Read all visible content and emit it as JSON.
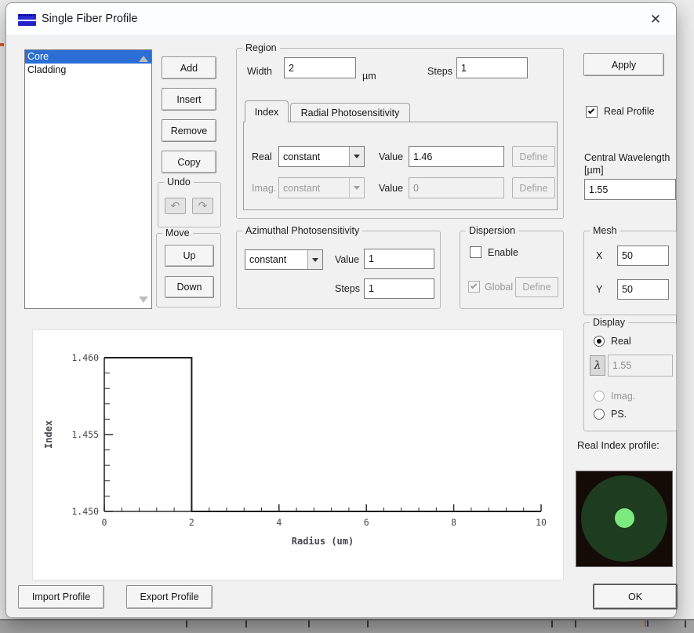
{
  "window": {
    "title": "Single Fiber Profile",
    "close_label": "✕"
  },
  "colors": {
    "selection_blue": "#2b6fd6",
    "title_icon_blue": "#2323cc",
    "profile_background": "#140a06",
    "profile_outer_circle": "#1e3c20",
    "profile_inner_circle": "#7ce97e"
  },
  "layer_list": {
    "items": [
      {
        "label": "Core",
        "selected": true
      },
      {
        "label": "Cladding",
        "selected": false
      }
    ]
  },
  "list_buttons": {
    "add": "Add",
    "insert": "Insert",
    "remove": "Remove",
    "copy": "Copy"
  },
  "undo_group": {
    "label": "Undo",
    "undo_icon": "↶",
    "redo_icon": "↷"
  },
  "move_group": {
    "label": "Move",
    "up": "Up",
    "down": "Down"
  },
  "region": {
    "label": "Region",
    "width_label": "Width",
    "width_value": "2",
    "width_unit": "µm",
    "steps_label": "Steps",
    "steps_value": "1",
    "tabs": {
      "index": "Index",
      "radial": "Radial Photosensitivity"
    },
    "real_label": "Real",
    "real_function": "constant",
    "real_value_label": "Value",
    "real_value": "1.46",
    "real_define": "Define",
    "imag_label": "Imag.",
    "imag_function": "constant",
    "imag_value_label": "Value",
    "imag_value": "0",
    "imag_define": "Define"
  },
  "right_panel": {
    "apply": "Apply",
    "real_profile": "Real Profile",
    "central_wavelength_label": "Central Wavelength [µm]",
    "central_wavelength_value": "1.55"
  },
  "azimuthal": {
    "label": "Azimuthal Photosensitivity",
    "function": "constant",
    "value_label": "Value",
    "value": "1",
    "steps_label": "Steps",
    "steps": "1"
  },
  "dispersion": {
    "label": "Dispersion",
    "enable": "Enable",
    "global": "Global",
    "define": "Define"
  },
  "mesh": {
    "label": "Mesh",
    "x_label": "X",
    "x_value": "50",
    "y_label": "Y",
    "y_value": "50"
  },
  "display": {
    "label": "Display",
    "real": "Real",
    "lambda": "λ",
    "lambda_value": "1.55",
    "imag": "Imag.",
    "ps": "PS."
  },
  "profile_preview": {
    "label": "Real Index profile:"
  },
  "chart_data": {
    "type": "line",
    "title": "",
    "xlabel": "Radius (um)",
    "ylabel": "Index",
    "xlim": [
      0,
      10
    ],
    "ylim": [
      1.45,
      1.46
    ],
    "xticks": [
      0,
      2,
      4,
      6,
      8,
      10
    ],
    "yticks": [
      1.45,
      1.455,
      1.46
    ],
    "x_minor_step": 0.4,
    "y_minor_step": 0.001,
    "grid": false,
    "legend": false,
    "series": [
      {
        "name": "real-index-step-profile",
        "points": [
          [
            0,
            1.46
          ],
          [
            2,
            1.46
          ],
          [
            2,
            1.45
          ],
          [
            10,
            1.45
          ]
        ]
      }
    ]
  },
  "footer": {
    "import": "Import Profile",
    "export": "Export Profile",
    "ok": "OK"
  }
}
